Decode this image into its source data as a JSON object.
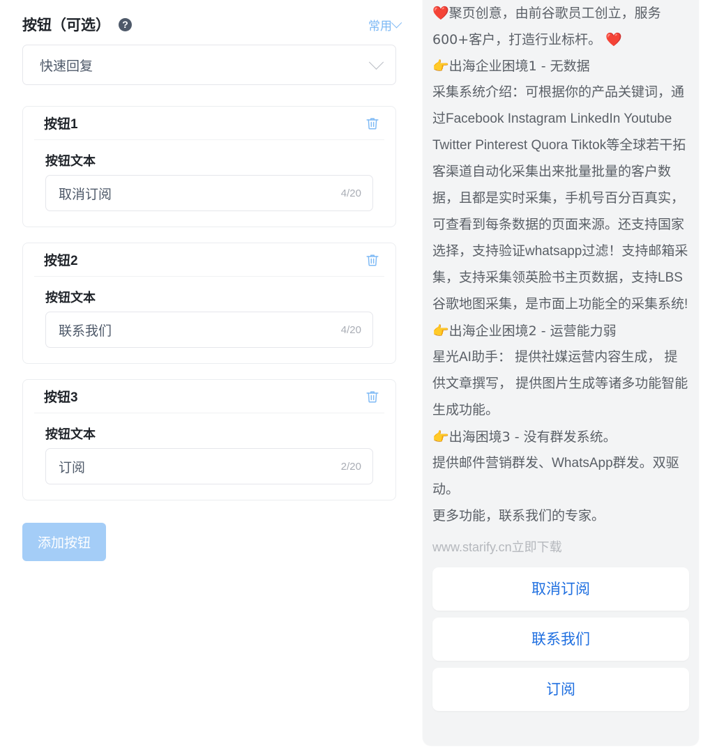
{
  "editor": {
    "section_title": "按钮（可选）",
    "help_icon": "question-mark-icon",
    "common_link": "常用",
    "select": {
      "value": "快速回复",
      "placeholder": "快速回复"
    },
    "field_label": "按钮文本",
    "buttons": [
      {
        "title": "按钮1",
        "text": "取消订阅",
        "counter": "4/20",
        "delete_icon": "trash-icon"
      },
      {
        "title": "按钮2",
        "text": "联系我们",
        "counter": "4/20",
        "delete_icon": "trash-icon"
      },
      {
        "title": "按钮3",
        "text": "订阅",
        "counter": "2/20",
        "delete_icon": "trash-icon"
      }
    ],
    "add_button_label": "添加按钮"
  },
  "preview": {
    "lines": [
      "❤️聚页创意，由前谷歌员工创立，服务600+客户，打造行业标杆。 ❤️",
      "👉出海企业困境1 - 无数据",
      "采集系统介绍：可根据你的产品关键词，通过Facebook Instagram LinkedIn Youtube Twitter Pinterest Quora Tiktok等全球若干拓客渠道自动化采集出来批量批量的客户数据，且都是实时采集，手机号百分百真实，可查看到每条数据的页面来源。还支持国家选择，支持验证whatsapp过滤！支持邮箱采集，支持采集领英脸书主页数据，支持LBS谷歌地图采集，是市面上功能全的采集系统!",
      "👉出海企业困境2 - 运营能力弱",
      "星光AI助手： 提供社媒运营内容生成， 提供文章撰写， 提供图片生成等诸多功能智能生成功能。",
      "👉出海困境3 - 没有群发系统。",
      "提供邮件营销群发、WhatsApp群发。双驱动。",
      "更多功能，联系我们的专家。"
    ],
    "site_link": "www.starify.cn立即下载",
    "buttons": [
      "取消订阅",
      "联系我们",
      "订阅"
    ]
  },
  "colors": {
    "accent_light_blue": "#7db9f5",
    "preview_button_blue": "#1f6fe0",
    "add_button_bg": "#a4cdf7",
    "preview_bg": "#f3f4f5",
    "text_primary": "#1f2329",
    "text_secondary": "#4e5969",
    "counter_gray": "#a9adb5"
  }
}
